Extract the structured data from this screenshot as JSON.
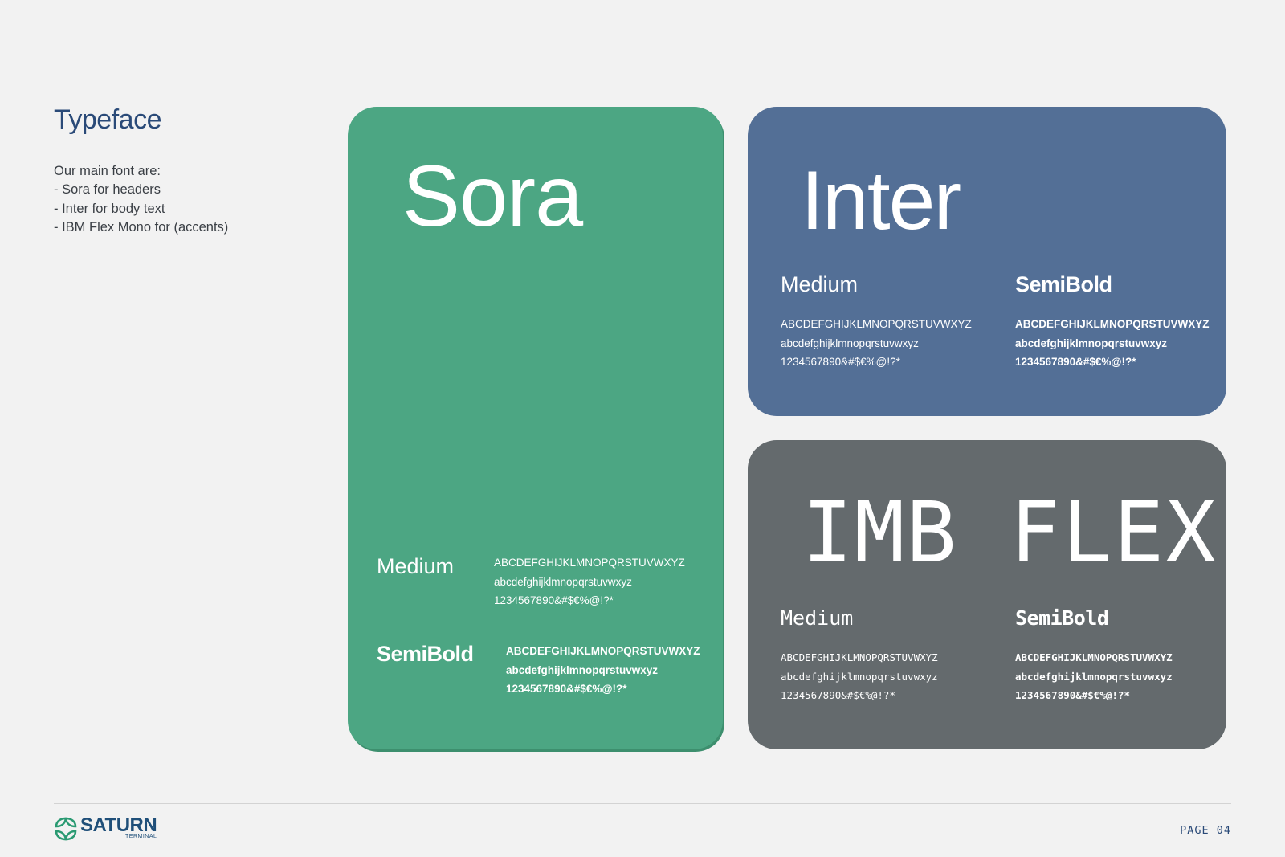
{
  "header": {
    "title": "Typeface",
    "intro_lines": [
      "Our main font are:",
      "- Sora for headers",
      "- Inter for body text",
      "- IBM Flex Mono for (accents)"
    ]
  },
  "cards": {
    "sora": {
      "name": "Sora",
      "color": "#4ca683",
      "medium": {
        "label": "Medium",
        "upper": "ABCDEFGHIJKLMNOPQRSTUVWXYZ",
        "lower": "abcdefghijklmnopqrstuvwxyz",
        "digits": "1234567890&#$€%@!?*"
      },
      "semibold": {
        "label": "SemiBold",
        "upper": "ABCDEFGHIJKLMNOPQRSTUVWXYZ",
        "lower": "abcdefghijklmnopqrstuvwxyz",
        "digits": "1234567890&#$€%@!?*"
      }
    },
    "inter": {
      "name": "Inter",
      "color": "#536f96",
      "medium": {
        "label": "Medium",
        "upper": "ABCDEFGHIJKLMNOPQRSTUVWXYZ",
        "lower": "abcdefghijklmnopqrstuvwxyz",
        "digits": "1234567890&#$€%@!?*"
      },
      "semibold": {
        "label": "SemiBold",
        "upper": "ABCDEFGHIJKLMNOPQRSTUVWXYZ",
        "lower": "abcdefghijklmnopqrstuvwxyz",
        "digits": "1234567890&#$€%@!?*"
      }
    },
    "mono": {
      "name": "IMB FLEX",
      "color": "#646a6d",
      "medium": {
        "label": "Medium",
        "upper": "ABCDEFGHIJKLMNOPQRSTUVWXYZ",
        "lower": "abcdefghijklmnopqrstuvwxyz",
        "digits": "1234567890&#$€%@!?*"
      },
      "semibold": {
        "label": "SemiBold",
        "upper": "ABCDEFGHIJKLMNOPQRSTUVWXYZ",
        "lower": "abcdefghijklmnopqrstuvwxyz",
        "digits": "1234567890&#$€%@!?*"
      }
    }
  },
  "footer": {
    "logo_text": "SATURN",
    "logo_subtext": "TERMINAL",
    "logo_icon": "saturn-logo-icon",
    "page_label": "PAGE 04"
  }
}
